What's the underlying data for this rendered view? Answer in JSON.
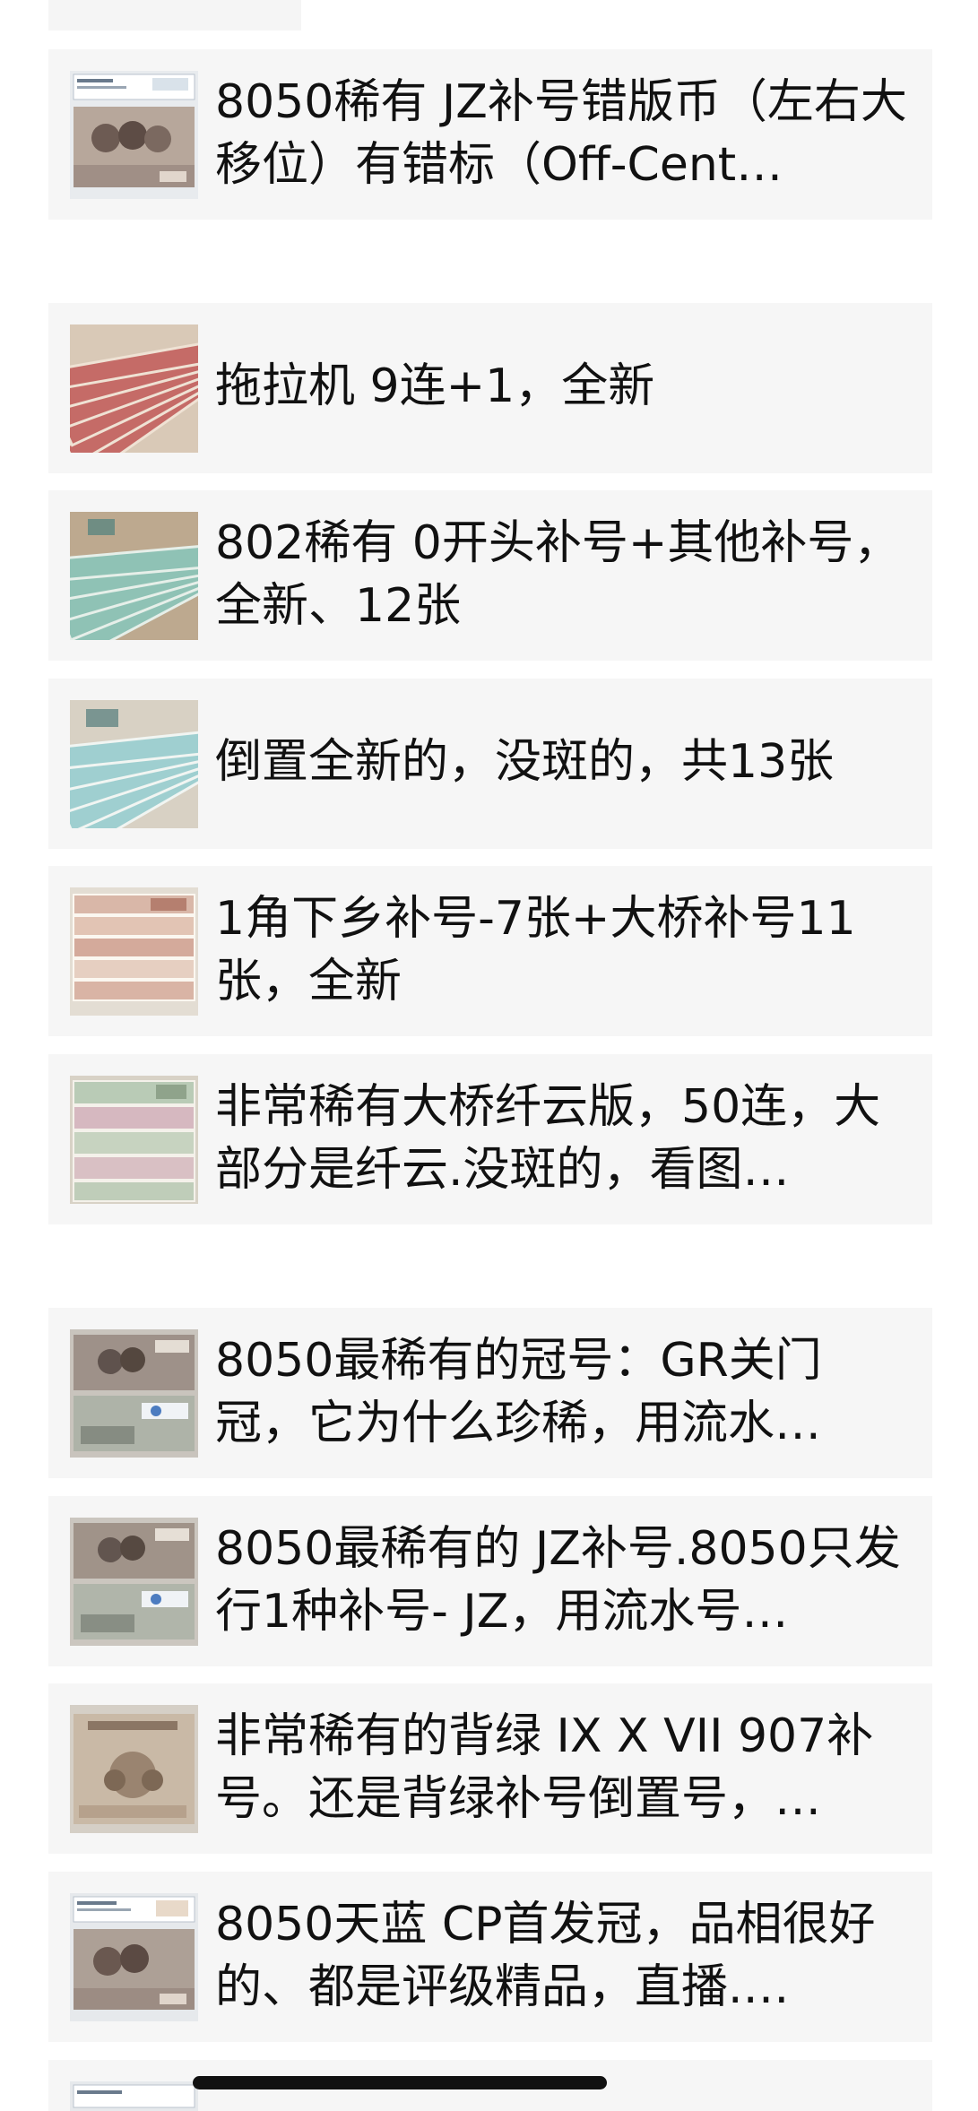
{
  "items": [
    {
      "title": "8050稀有 JZ补号错版币（左右大移位）有错标（Off-Cent…",
      "thumb_icon": "banknote-graded-slab-image"
    },
    {
      "title": "拖拉机 9连+1，全新",
      "thumb_icon": "banknote-fan-image"
    },
    {
      "title": "802稀有 0开头补号+其他补号，全新、12张",
      "thumb_icon": "banknote-fan-image"
    },
    {
      "title": "倒置全新的，没斑的，共13张",
      "thumb_icon": "banknote-fan-image"
    },
    {
      "title": "1角下乡补号-7张+大桥补号11张，全新",
      "thumb_icon": "banknote-stack-image"
    },
    {
      "title": "非常稀有大桥纤云版，50连，大部分是纤云.没斑的，看图…",
      "thumb_icon": "banknote-stack-image"
    },
    {
      "title": "8050最稀有的冠号：GR关门冠，它为什么珍稀，用流水…",
      "thumb_icon": "banknote-front-back-image"
    },
    {
      "title": "8050最稀有的 JZ补号.8050只发行1种补号- JZ，用流水号…",
      "thumb_icon": "banknote-front-back-image"
    },
    {
      "title": "非常稀有的背绿 IX X VII 907补号。还是背绿补号倒置号，…",
      "thumb_icon": "banknote-single-image"
    },
    {
      "title": "8050天蓝 CP首发冠，品相很好的、都是评级精品，直播.…",
      "thumb_icon": "banknote-graded-slab-image"
    }
  ]
}
